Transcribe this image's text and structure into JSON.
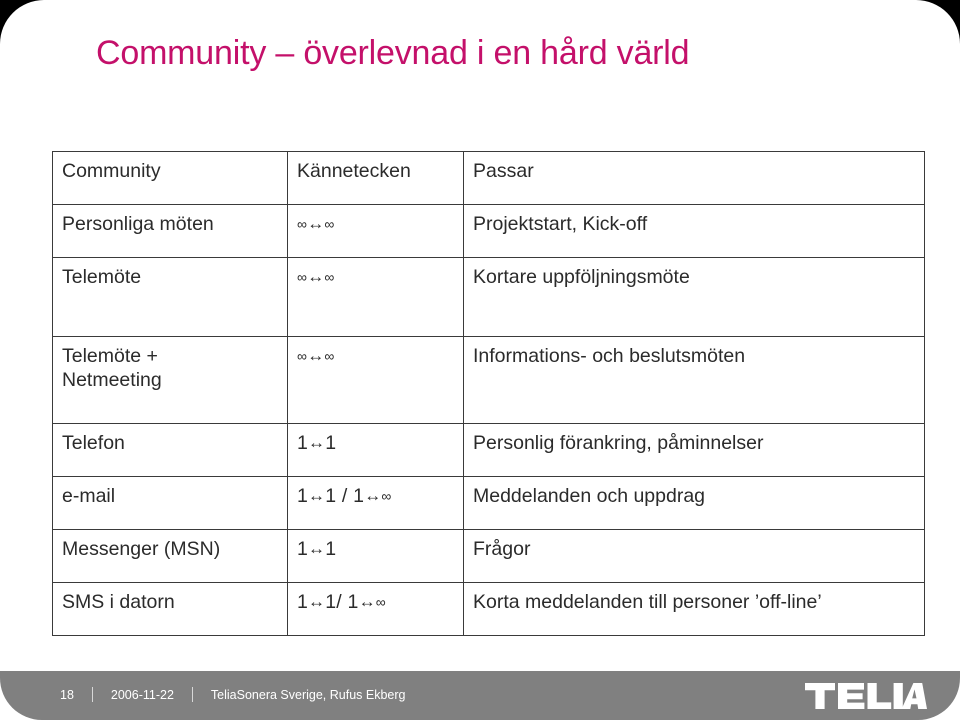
{
  "slide": {
    "title": "Community – överlevnad i en hård värld",
    "title_color": "#C4106A",
    "background_color": "#FFFFFF",
    "footer_bar_color": "#808080"
  },
  "table": {
    "headers": [
      "Community",
      "Kännetecken",
      "Passar"
    ],
    "rows": [
      {
        "community": "Personliga möten",
        "kannetecken": "∞↔∞",
        "kannetecken_parts": [
          {
            "t": "∞",
            "k": "inf"
          },
          {
            "t": "↔",
            "k": "arw"
          },
          {
            "t": "∞",
            "k": "inf"
          }
        ],
        "passar": "Projektstart, Kick-off"
      },
      {
        "community": "Telemöte",
        "kannetecken": "∞↔∞",
        "kannetecken_parts": [
          {
            "t": "∞",
            "k": "inf"
          },
          {
            "t": "↔",
            "k": "arw"
          },
          {
            "t": "∞",
            "k": "inf"
          }
        ],
        "passar": "Kortare uppföljningsmöte"
      },
      {
        "community": "Telemöte +\nNetmeeting",
        "kannetecken": "∞↔∞",
        "kannetecken_parts": [
          {
            "t": "∞",
            "k": "inf"
          },
          {
            "t": "↔",
            "k": "arw"
          },
          {
            "t": "∞",
            "k": "inf"
          }
        ],
        "passar": "Informations- och beslutsmöten"
      },
      {
        "community": "Telefon",
        "kannetecken": "1↔1",
        "kannetecken_parts": [
          {
            "t": "1",
            "k": "num"
          },
          {
            "t": "↔",
            "k": "arw"
          },
          {
            "t": "1",
            "k": "num"
          }
        ],
        "passar": "Personlig förankring, påminnelser"
      },
      {
        "community": "e-mail",
        "kannetecken": "1↔1 / 1↔∞",
        "kannetecken_parts": [
          {
            "t": "1",
            "k": "num"
          },
          {
            "t": "↔",
            "k": "arw"
          },
          {
            "t": "1 / 1",
            "k": "num"
          },
          {
            "t": "↔",
            "k": "arw"
          },
          {
            "t": "∞",
            "k": "inf"
          }
        ],
        "passar": "Meddelanden och uppdrag"
      },
      {
        "community": "Messenger (MSN)",
        "kannetecken": "1↔1",
        "kannetecken_parts": [
          {
            "t": "1",
            "k": "num"
          },
          {
            "t": "↔",
            "k": "arw"
          },
          {
            "t": "1",
            "k": "num"
          }
        ],
        "passar": "Frågor"
      },
      {
        "community": "SMS i datorn",
        "kannetecken": "1↔1/ 1↔∞",
        "kannetecken_parts": [
          {
            "t": "1",
            "k": "num"
          },
          {
            "t": "↔",
            "k": "arw"
          },
          {
            "t": "1/ 1",
            "k": "num"
          },
          {
            "t": "↔",
            "k": "arw"
          },
          {
            "t": "∞",
            "k": "inf"
          }
        ],
        "passar": "Korta meddelanden till personer ’off-line’"
      }
    ]
  },
  "footer": {
    "page_number": "18",
    "date": "2006-11-22",
    "attribution": "TeliaSonera Sverige, Rufus Ekberg",
    "logo_text": "TELIA"
  }
}
